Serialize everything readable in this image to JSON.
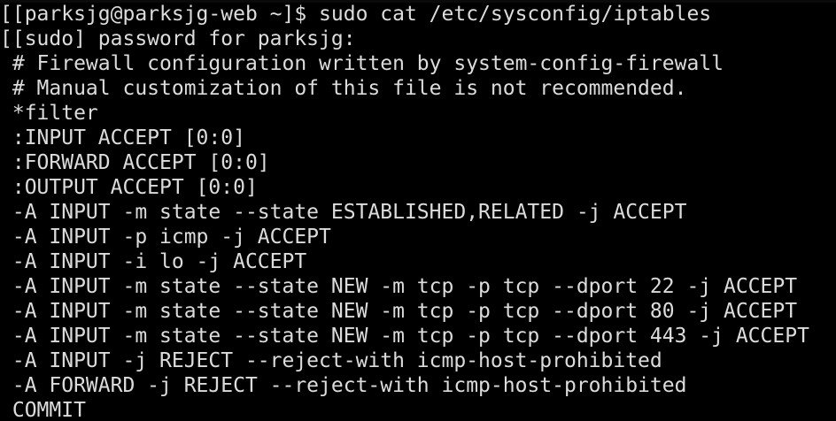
{
  "terminal": {
    "text_color": "#dcdcdc",
    "background": "#000000",
    "lines": [
      "[[parksjg@parksjg-web ~]$ sudo cat /etc/sysconfig/iptables",
      "[[sudo] password for parksjg:",
      " # Firewall configuration written by system-config-firewall",
      " # Manual customization of this file is not recommended.",
      " *filter",
      " :INPUT ACCEPT [0:0]",
      " :FORWARD ACCEPT [0:0]",
      " :OUTPUT ACCEPT [0:0]",
      " -A INPUT -m state --state ESTABLISHED,RELATED -j ACCEPT",
      " -A INPUT -p icmp -j ACCEPT",
      " -A INPUT -i lo -j ACCEPT",
      " -A INPUT -m state --state NEW -m tcp -p tcp --dport 22 -j ACCEPT",
      " -A INPUT -m state --state NEW -m tcp -p tcp --dport 80 -j ACCEPT",
      " -A INPUT -m state --state NEW -m tcp -p tcp --dport 443 -j ACCEPT",
      " -A INPUT -j REJECT --reject-with icmp-host-prohibited",
      " -A FORWARD -j REJECT --reject-with icmp-host-prohibited",
      " COMMIT"
    ]
  }
}
